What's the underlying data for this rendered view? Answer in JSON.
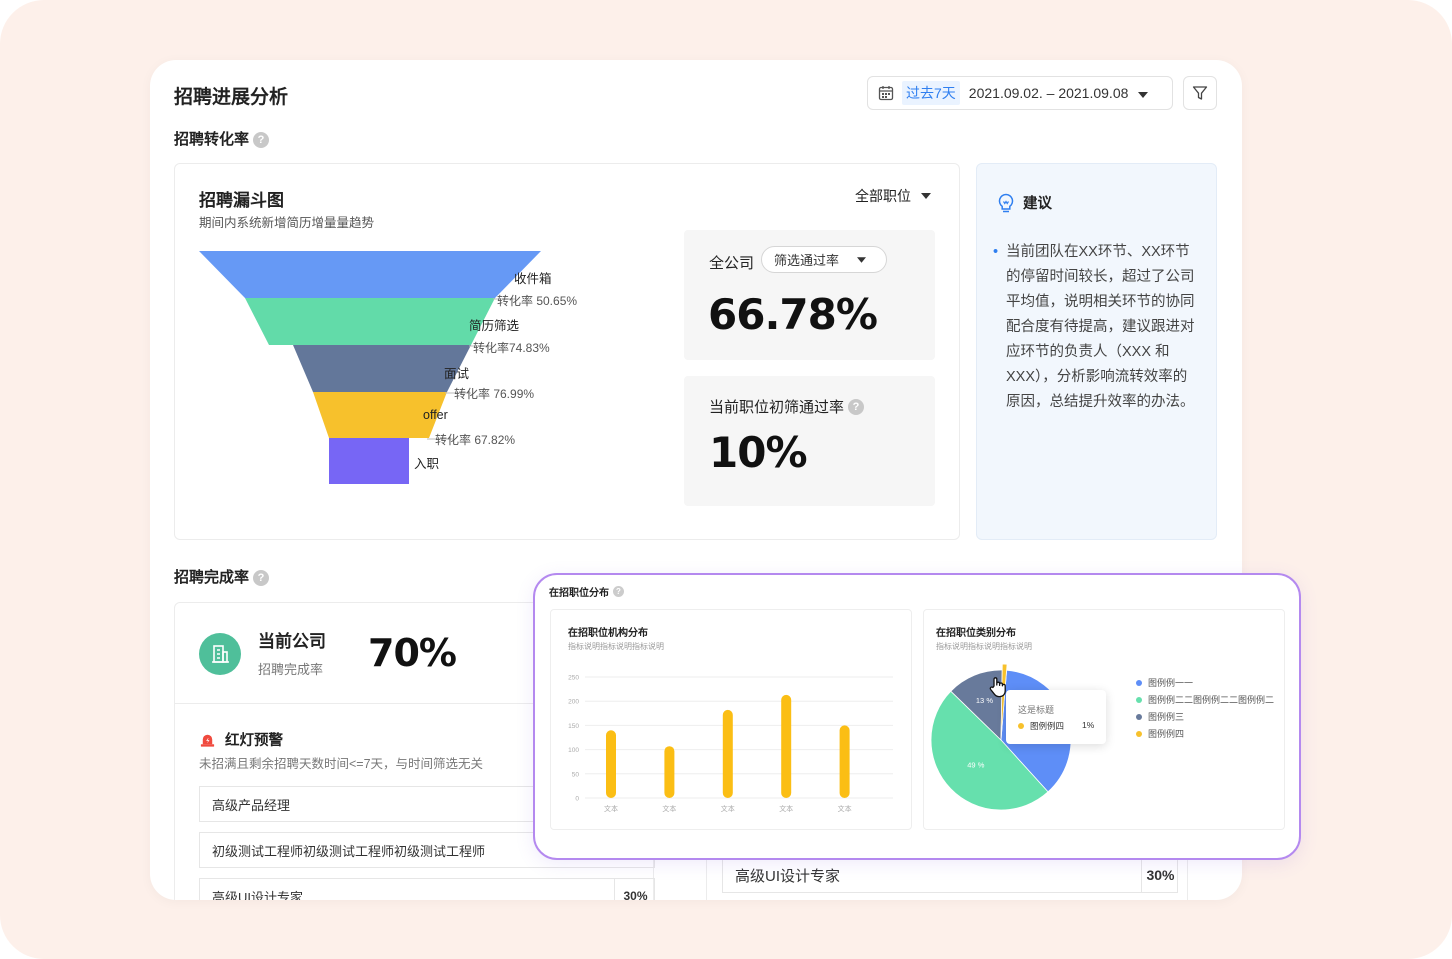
{
  "header": {
    "title": "招聘进展分析",
    "date_tag": "过去7天",
    "date_range": "2021.09.02. – 2021.09.08"
  },
  "conversion": {
    "section_title": "招聘转化率",
    "funnel": {
      "title": "招聘漏斗图",
      "subtitle": "期间内系统新增简历增量量趋势",
      "position_select": "全部职位",
      "stages": [
        {
          "name": "收件箱",
          "color": "#6699f5"
        },
        {
          "name": "简历筛选",
          "color": "#62dba9"
        },
        {
          "name": "面试",
          "color": "#63779a"
        },
        {
          "name": "offer",
          "color": "#f7c12c"
        },
        {
          "name": "入职",
          "color": "#7766f5"
        }
      ],
      "rates": [
        "转化率 50.65%",
        "转化率74.83%",
        "转化率 76.99%",
        "转化率 67.82%"
      ]
    },
    "company_label": "全公司",
    "rate_select": "筛选通过率",
    "company_rate": "66.78%",
    "current_label": "当前职位初筛通过率",
    "current_rate": "10%"
  },
  "suggestion": {
    "title": "建议",
    "lines": [
      "当前团队在XX环节、XX环节",
      "的停留时间较长，超过了公司",
      "平均值，说明相关环节的协同",
      "配合度有待提高，建议跟进对",
      "应环节的负责人（XXX 和",
      "XXX），分析影响流转效率的",
      "原因，总结提升效率的办法。"
    ]
  },
  "completion": {
    "section_title": "招聘完成率",
    "company_title": "当前公司",
    "company_sub": "招聘完成率",
    "company_value": "70%",
    "alert_title": "红灯预警",
    "alert_desc": "未招满且剩余招聘天数时间<=7天，与时间筛选无关",
    "rows": [
      {
        "name": "高级产品经理",
        "value": ""
      },
      {
        "name": "初级测试工程师初级测试工程师初级测试工程师",
        "value": ""
      },
      {
        "name": "高级UI设计专家",
        "value": "30%"
      }
    ],
    "right_row": {
      "name": "高级UI设计专家",
      "value": "30%"
    }
  },
  "distribution": {
    "title": "在招职位分布",
    "bar_card_title": "在招职位机构分布",
    "bar_card_desc": "指标说明指标说明指标说明",
    "pie_card_title": "在招职位类别分布",
    "pie_card_desc": "指标说明指标说明指标说明",
    "tooltip_title": "这是标题",
    "tooltip_series": "图例例四",
    "tooltip_value": "1%"
  },
  "chart_data": [
    {
      "type": "bar",
      "categories": [
        "文本",
        "文本",
        "文本",
        "文本",
        "文本"
      ],
      "values": [
        140,
        107,
        182,
        213,
        150
      ],
      "ylim": [
        0,
        250
      ],
      "yticks": [
        "0",
        "50",
        "100",
        "150",
        "200",
        "250"
      ],
      "grid": true,
      "color": "#fbbe14"
    },
    {
      "type": "pie",
      "slices": [
        {
          "name": "图例例一一",
          "value": 37,
          "color": "#5e8ef7"
        },
        {
          "name": "图例例二二图例例二二图例例二",
          "value": 49,
          "color": "#66e0ad",
          "label": "49 %"
        },
        {
          "name": "图例例三",
          "value": 13,
          "color": "#687a9b",
          "label": "13 %"
        },
        {
          "name": "图例例四",
          "value": 1,
          "color": "#f7c12c"
        }
      ],
      "legend": "right"
    }
  ]
}
